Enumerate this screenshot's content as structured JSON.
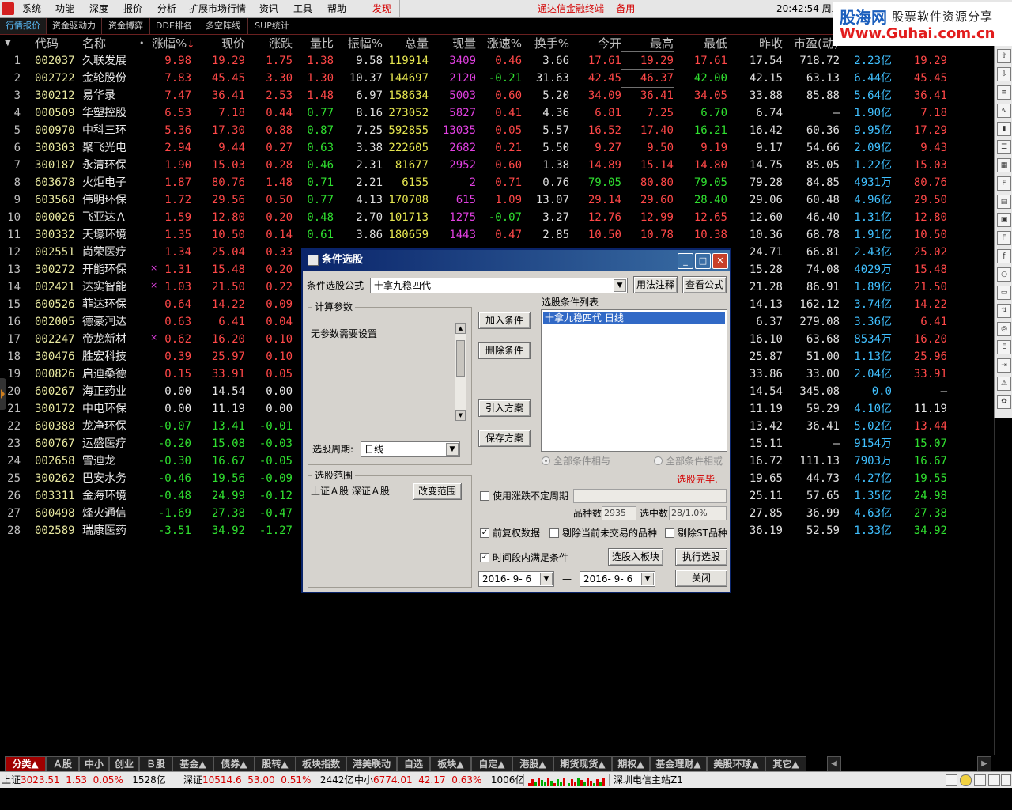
{
  "menu": {
    "items": [
      "系统",
      "功能",
      "深度",
      "报价",
      "分析",
      "扩展市场行情",
      "资讯",
      "工具",
      "帮助"
    ],
    "discover": "发现",
    "terminal_title": "通达信金融终端",
    "backup": "备用",
    "clock": "20:42:54 周二"
  },
  "watermark": {
    "cn": "股海网",
    "cn2": "股票软件资源分享",
    "url": "Www.Guhai.com.cn"
  },
  "tabs": [
    "行情报价",
    "资金驱动力",
    "资金博弈",
    "DDE排名",
    "多空阵线",
    "SUP统计"
  ],
  "header": [
    "代码",
    "名称",
    "•",
    "涨幅%",
    "现价",
    "涨跌",
    "量比",
    "振幅%",
    "总量",
    "现量",
    "涨速%",
    "换手%",
    "今开",
    "最高",
    "最低",
    "昨收",
    "市盈(动)",
    "流通市值",
    "买价"
  ],
  "header_sort_arrow": "↓",
  "rows": [
    {
      "idx": "1",
      "code": "002037",
      "name": "久联发展",
      "mark": "",
      "chg": "9.98",
      "price": "19.29",
      "diff": "1.75",
      "vr": "1.38",
      "amp": "9.58",
      "vol": "119914",
      "cur": "3409",
      "spd": "0.46",
      "turn": "3.66",
      "open": "17.61",
      "high": "19.29",
      "low": "17.61",
      "prev": "17.54",
      "pe": "718.72",
      "cap": "2.23亿",
      "bid": "19.29"
    },
    {
      "idx": "2",
      "code": "002722",
      "name": "金轮股份",
      "mark": "",
      "chg": "7.83",
      "price": "45.45",
      "diff": "3.30",
      "vr": "1.30",
      "amp": "10.37",
      "vol": "144697",
      "cur": "2120",
      "spd": "-0.21",
      "turn": "31.63",
      "open": "42.45",
      "high": "46.37",
      "low": "42.00",
      "prev": "42.15",
      "pe": "63.13",
      "cap": "6.44亿",
      "bid": "45.45"
    },
    {
      "idx": "3",
      "code": "300212",
      "name": "易华录",
      "mark": "",
      "chg": "7.47",
      "price": "36.41",
      "diff": "2.53",
      "vr": "1.48",
      "amp": "6.97",
      "vol": "158634",
      "cur": "5003",
      "spd": "0.60",
      "turn": "5.20",
      "open": "34.09",
      "high": "36.41",
      "low": "34.05",
      "prev": "33.88",
      "pe": "85.88",
      "cap": "5.64亿",
      "bid": "36.41"
    },
    {
      "idx": "4",
      "code": "000509",
      "name": "华塑控股",
      "mark": "",
      "chg": "6.53",
      "price": "7.18",
      "diff": "0.44",
      "vr": "0.77",
      "amp": "8.16",
      "vol": "273052",
      "cur": "5827",
      "spd": "0.41",
      "turn": "4.36",
      "open": "6.81",
      "high": "7.25",
      "low": "6.70",
      "prev": "6.74",
      "pe": "—",
      "cap": "1.90亿",
      "bid": "7.18"
    },
    {
      "idx": "5",
      "code": "000970",
      "name": "中科三环",
      "mark": "",
      "chg": "5.36",
      "price": "17.30",
      "diff": "0.88",
      "vr": "0.87",
      "amp": "7.25",
      "vol": "592855",
      "cur": "13035",
      "spd": "0.05",
      "turn": "5.57",
      "open": "16.52",
      "high": "17.40",
      "low": "16.21",
      "prev": "16.42",
      "pe": "60.36",
      "cap": "9.95亿",
      "bid": "17.29"
    },
    {
      "idx": "6",
      "code": "300303",
      "name": "聚飞光电",
      "mark": "",
      "chg": "2.94",
      "price": "9.44",
      "diff": "0.27",
      "vr": "0.63",
      "amp": "3.38",
      "vol": "222605",
      "cur": "2682",
      "spd": "0.21",
      "turn": "5.50",
      "open": "9.27",
      "high": "9.50",
      "low": "9.19",
      "prev": "9.17",
      "pe": "54.66",
      "cap": "2.09亿",
      "bid": "9.43"
    },
    {
      "idx": "7",
      "code": "300187",
      "name": "永清环保",
      "mark": "",
      "chg": "1.90",
      "price": "15.03",
      "diff": "0.28",
      "vr": "0.46",
      "amp": "2.31",
      "vol": "81677",
      "cur": "2952",
      "spd": "0.60",
      "turn": "1.38",
      "open": "14.89",
      "high": "15.14",
      "low": "14.80",
      "prev": "14.75",
      "pe": "85.05",
      "cap": "1.22亿",
      "bid": "15.03"
    },
    {
      "idx": "8",
      "code": "603678",
      "name": "火炬电子",
      "mark": "",
      "chg": "1.87",
      "price": "80.76",
      "diff": "1.48",
      "vr": "0.71",
      "amp": "2.21",
      "vol": "6155",
      "cur": "2",
      "spd": "0.71",
      "turn": "0.76",
      "open": "79.05",
      "high": "80.80",
      "low": "79.05",
      "prev": "79.28",
      "pe": "84.85",
      "cap": "4931万",
      "bid": "80.76"
    },
    {
      "idx": "9",
      "code": "603568",
      "name": "伟明环保",
      "mark": "",
      "chg": "1.72",
      "price": "29.56",
      "diff": "0.50",
      "vr": "0.77",
      "amp": "4.13",
      "vol": "170708",
      "cur": "615",
      "spd": "1.09",
      "turn": "13.07",
      "open": "29.14",
      "high": "29.60",
      "low": "28.40",
      "prev": "29.06",
      "pe": "60.48",
      "cap": "4.96亿",
      "bid": "29.50"
    },
    {
      "idx": "10",
      "code": "000026",
      "name": "飞亚达Ａ",
      "mark": "",
      "chg": "1.59",
      "price": "12.80",
      "diff": "0.20",
      "vr": "0.48",
      "amp": "2.70",
      "vol": "101713",
      "cur": "1275",
      "spd": "-0.07",
      "turn": "3.27",
      "open": "12.76",
      "high": "12.99",
      "low": "12.65",
      "prev": "12.60",
      "pe": "46.40",
      "cap": "1.31亿",
      "bid": "12.80"
    },
    {
      "idx": "11",
      "code": "300332",
      "name": "天壕环境",
      "mark": "",
      "chg": "1.35",
      "price": "10.50",
      "diff": "0.14",
      "vr": "0.61",
      "amp": "3.86",
      "vol": "180659",
      "cur": "1443",
      "spd": "0.47",
      "turn": "2.85",
      "open": "10.50",
      "high": "10.78",
      "low": "10.38",
      "prev": "10.36",
      "pe": "68.78",
      "cap": "1.91亿",
      "bid": "10.50"
    },
    {
      "idx": "12",
      "code": "002551",
      "name": "尚荣医疗",
      "mark": "",
      "chg": "1.34",
      "price": "25.04",
      "diff": "0.33",
      "vr": "",
      "amp": "",
      "vol": "",
      "cur": "",
      "spd": "",
      "turn": "",
      "open": "",
      "high": "",
      "low": "",
      "prev": "24.71",
      "pe": "66.81",
      "cap": "2.43亿",
      "bid": "25.02"
    },
    {
      "idx": "13",
      "code": "300272",
      "name": "开能环保",
      "mark": "×",
      "chg": "1.31",
      "price": "15.48",
      "diff": "0.20",
      "vr": "",
      "amp": "",
      "vol": "",
      "cur": "",
      "spd": "",
      "turn": "",
      "open": "",
      "high": "",
      "low": "",
      "prev": "15.28",
      "pe": "74.08",
      "cap": "4029万",
      "bid": "15.48"
    },
    {
      "idx": "14",
      "code": "002421",
      "name": "达实智能",
      "mark": "×",
      "chg": "1.03",
      "price": "21.50",
      "diff": "0.22",
      "vr": "",
      "amp": "",
      "vol": "",
      "cur": "",
      "spd": "",
      "turn": "",
      "open": "",
      "high": "",
      "low": "",
      "prev": "21.28",
      "pe": "86.91",
      "cap": "1.89亿",
      "bid": "21.50"
    },
    {
      "idx": "15",
      "code": "600526",
      "name": "菲达环保",
      "mark": "",
      "chg": "0.64",
      "price": "14.22",
      "diff": "0.09",
      "vr": "",
      "amp": "",
      "vol": "",
      "cur": "",
      "spd": "",
      "turn": "",
      "open": "",
      "high": "",
      "low": "",
      "prev": "14.13",
      "pe": "162.12",
      "cap": "3.74亿",
      "bid": "14.22"
    },
    {
      "idx": "16",
      "code": "002005",
      "name": "德豪润达",
      "mark": "",
      "chg": "0.63",
      "price": "6.41",
      "diff": "0.04",
      "vr": "",
      "amp": "",
      "vol": "",
      "cur": "",
      "spd": "",
      "turn": "",
      "open": "",
      "high": "",
      "low": "",
      "prev": "6.37",
      "pe": "279.08",
      "cap": "3.36亿",
      "bid": "6.41"
    },
    {
      "idx": "17",
      "code": "002247",
      "name": "帝龙新材",
      "mark": "×",
      "chg": "0.62",
      "price": "16.20",
      "diff": "0.10",
      "vr": "",
      "amp": "",
      "vol": "",
      "cur": "",
      "spd": "",
      "turn": "",
      "open": "",
      "high": "",
      "low": "",
      "prev": "16.10",
      "pe": "63.68",
      "cap": "8534万",
      "bid": "16.20"
    },
    {
      "idx": "18",
      "code": "300476",
      "name": "胜宏科技",
      "mark": "",
      "chg": "0.39",
      "price": "25.97",
      "diff": "0.10",
      "vr": "",
      "amp": "",
      "vol": "",
      "cur": "",
      "spd": "",
      "turn": "",
      "open": "",
      "high": "",
      "low": "",
      "prev": "25.87",
      "pe": "51.00",
      "cap": "1.13亿",
      "bid": "25.96"
    },
    {
      "idx": "19",
      "code": "000826",
      "name": "启迪桑德",
      "mark": "",
      "chg": "0.15",
      "price": "33.91",
      "diff": "0.05",
      "vr": "",
      "amp": "",
      "vol": "",
      "cur": "",
      "spd": "",
      "turn": "",
      "open": "",
      "high": "",
      "low": "",
      "prev": "33.86",
      "pe": "33.00",
      "cap": "2.04亿",
      "bid": "33.91"
    },
    {
      "idx": "20",
      "code": "600267",
      "name": "海正药业",
      "mark": "",
      "chg": "0.00",
      "price": "14.54",
      "diff": "0.00",
      "vr": "",
      "amp": "",
      "vol": "",
      "cur": "",
      "spd": "",
      "turn": "",
      "open": "",
      "high": "",
      "low": "",
      "prev": "14.54",
      "pe": "345.08",
      "cap": "0.0",
      "bid": "—"
    },
    {
      "idx": "21",
      "code": "300172",
      "name": "中电环保",
      "mark": "",
      "chg": "0.00",
      "price": "11.19",
      "diff": "0.00",
      "vr": "",
      "amp": "",
      "vol": "",
      "cur": "",
      "spd": "",
      "turn": "",
      "open": "",
      "high": "",
      "low": "",
      "prev": "11.19",
      "pe": "59.29",
      "cap": "4.10亿",
      "bid": "11.19"
    },
    {
      "idx": "22",
      "code": "600388",
      "name": "龙净环保",
      "mark": "",
      "chg": "-0.07",
      "price": "13.41",
      "diff": "-0.01",
      "vr": "",
      "amp": "",
      "vol": "",
      "cur": "",
      "spd": "",
      "turn": "",
      "open": "",
      "high": "",
      "low": "",
      "prev": "13.42",
      "pe": "36.41",
      "cap": "5.02亿",
      "bid": "13.44"
    },
    {
      "idx": "23",
      "code": "600767",
      "name": "运盛医疗",
      "mark": "",
      "chg": "-0.20",
      "price": "15.08",
      "diff": "-0.03",
      "vr": "",
      "amp": "",
      "vol": "",
      "cur": "",
      "spd": "",
      "turn": "",
      "open": "",
      "high": "",
      "low": "",
      "prev": "15.11",
      "pe": "—",
      "cap": "9154万",
      "bid": "15.07"
    },
    {
      "idx": "24",
      "code": "002658",
      "name": "雪迪龙",
      "mark": "",
      "chg": "-0.30",
      "price": "16.67",
      "diff": "-0.05",
      "vr": "",
      "amp": "",
      "vol": "",
      "cur": "",
      "spd": "",
      "turn": "",
      "open": "",
      "high": "",
      "low": "",
      "prev": "16.72",
      "pe": "111.13",
      "cap": "7903万",
      "bid": "16.67"
    },
    {
      "idx": "25",
      "code": "300262",
      "name": "巴安水务",
      "mark": "",
      "chg": "-0.46",
      "price": "19.56",
      "diff": "-0.09",
      "vr": "",
      "amp": "",
      "vol": "",
      "cur": "",
      "spd": "",
      "turn": "",
      "open": "",
      "high": "",
      "low": "",
      "prev": "19.65",
      "pe": "44.73",
      "cap": "4.27亿",
      "bid": "19.55"
    },
    {
      "idx": "26",
      "code": "603311",
      "name": "金海环境",
      "mark": "",
      "chg": "-0.48",
      "price": "24.99",
      "diff": "-0.12",
      "vr": "",
      "amp": "",
      "vol": "",
      "cur": "",
      "spd": "",
      "turn": "",
      "open": "",
      "high": "",
      "low": "",
      "prev": "25.11",
      "pe": "57.65",
      "cap": "1.35亿",
      "bid": "24.98"
    },
    {
      "idx": "27",
      "code": "600498",
      "name": "烽火通信",
      "mark": "",
      "chg": "-1.69",
      "price": "27.38",
      "diff": "-0.47",
      "vr": "",
      "amp": "",
      "vol": "",
      "cur": "",
      "spd": "",
      "turn": "",
      "open": "",
      "high": "",
      "low": "",
      "prev": "27.85",
      "pe": "36.99",
      "cap": "4.63亿",
      "bid": "27.38"
    },
    {
      "idx": "28",
      "code": "002589",
      "name": "瑞康医药",
      "mark": "",
      "chg": "-3.51",
      "price": "34.92",
      "diff": "-1.27",
      "vr": "",
      "amp": "",
      "vol": "",
      "cur": "",
      "spd": "",
      "turn": "",
      "open": "",
      "high": "",
      "low": "",
      "prev": "36.19",
      "pe": "52.59",
      "cap": "1.33亿",
      "bid": "34.92"
    }
  ],
  "dialog": {
    "title": "条件选股",
    "formula_label": "条件选股公式",
    "formula_value": "十拿九稳四代 -",
    "usage_button": "用法注释",
    "view_formula_button": "查看公式",
    "params_group": "计算参数",
    "params_text": "无参数需要设置",
    "period_label": "选股周期:",
    "period_value": "日线",
    "range_group": "选股范围",
    "range_value": "上证Ａ股 深证Ａ股",
    "change_range_button": "改变范围",
    "add_condition_button": "加入条件",
    "delete_condition_button": "删除条件",
    "import_plan_button": "引入方案",
    "save_plan_button": "保存方案",
    "conditions_list_label": "选股条件列表",
    "conditions": [
      "十拿九稳四代   日线"
    ],
    "radio_and": "全部条件相与",
    "radio_or": "全部条件相或",
    "status": "选股完毕.",
    "use_volatility_label": "使用涨跌不定周期",
    "count_label": "品种数",
    "count_value": "2935",
    "selected_label": "选中数",
    "selected_value": "28/1.0%",
    "adjusted_label": "前复权数据",
    "exclude_untraded_label": "剔除当前未交易的品种",
    "exclude_st_label": "剔除ST品种",
    "time_range_label": "时间段内满足条件",
    "to_block_button": "选股入板块",
    "execute_button": "执行选股",
    "date_from": "2016- 9- 6",
    "date_sep": "—",
    "date_to": "2016- 9- 6",
    "close_button": "关闭",
    "adjusted_checked": true,
    "time_range_checked": true,
    "use_volatility_checked": false,
    "exclude_untraded_checked": false,
    "exclude_st_checked": false
  },
  "category_tabs": [
    "分类▲",
    "Ａ股",
    "中小",
    "创业",
    "Ｂ股",
    "基金▲",
    "债券▲",
    "股转▲",
    "板块指数",
    "港美联动",
    "自选",
    "板块▲",
    "自定▲",
    "港股▲",
    "期货现货▲",
    "期权▲",
    "基金理财▲",
    "美股环球▲",
    "其它▲"
  ],
  "status": {
    "sh_label": "上证",
    "sh_index": "3023.51",
    "sh_chg": "1.53",
    "sh_pct": "0.05%",
    "sh_amt": "1528亿",
    "sz_label": "深证",
    "sz_index": "10514.6",
    "sz_chg": "53.00",
    "sz_pct": "0.51%",
    "sz_amt": "2442亿",
    "zx_label": "中小",
    "zx_index": "6774.01",
    "zx_chg": "42.17",
    "zx_pct": "0.63%",
    "zx_amt": "1006亿",
    "server": "深圳电信主站Z1"
  },
  "colors": {
    "up": "#ff4848",
    "down": "#30e030",
    "code": "#e8e8a0",
    "volume": "#e6e650",
    "current_volume": "#e040e0",
    "cap": "#40c0ff"
  }
}
